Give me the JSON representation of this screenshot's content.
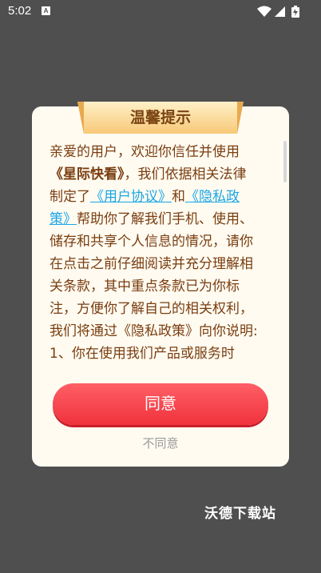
{
  "status_bar": {
    "time": "5:02",
    "notification_glyph": "A",
    "icons": [
      "wifi-icon",
      "signal-icon",
      "battery-icon"
    ]
  },
  "dialog": {
    "title": "温馨提示",
    "body": {
      "intro": "亲爱的用户，欢迎你信任并使用",
      "app_name": "《星际快看》",
      "mid1": "，我们依据相关法律制定了",
      "link_user_agreement": "《用户协议》",
      "and": "和",
      "link_privacy_policy": "《隐私政策》",
      "mid2": "帮助你了解我们手机、使用、储存和共享个人信息的情况，请你在点击之前仔细阅读并充分理解相关条款，其中重点条款已为你标注，方便你了解自己的相关权利，我们将通过《隐私政策》向你说明:",
      "item1": "1、你在使用我们产品或服务时"
    },
    "agree_label": "同意",
    "disagree_label": "不同意"
  },
  "watermark": "沃德下载站",
  "colors": {
    "overlay": "#4f4f4f",
    "dialog_bg": "#fffbf1",
    "body_text": "#7a3d0f",
    "link": "#1aa6e6",
    "agree_button": "#f0323c",
    "disagree_text": "#9a9a9a",
    "title_banner": "#fbd78f"
  }
}
